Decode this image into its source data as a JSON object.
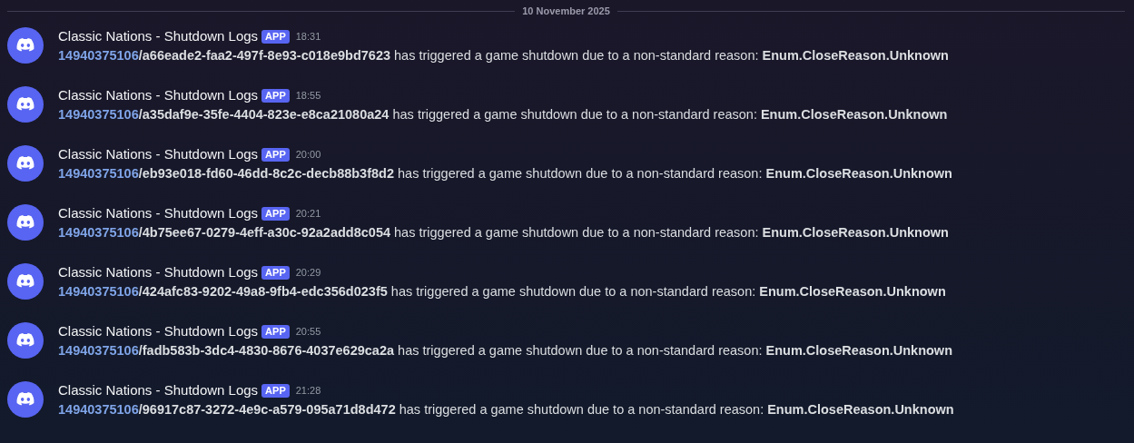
{
  "date_divider": "10 November 2025",
  "messages": [
    {
      "author": "Classic Nations - Shutdown Logs",
      "badge": "APP",
      "time": "18:31",
      "link": "14940375106",
      "text": "**/a66eade2-faa2-497f-8e93-c018e9bd7623** has triggered a game shutdown due to a non-standard reason: **Enum.CloseReason.Unknown**"
    },
    {
      "author": "Classic Nations - Shutdown Logs",
      "badge": "APP",
      "time": "18:55",
      "link": "14940375106",
      "text": "**/a35daf9e-35fe-4404-823e-e8ca21080a24** has triggered a game shutdown due to a non-standard reason: **Enum.CloseReason.Unknown**"
    },
    {
      "author": "Classic Nations - Shutdown Logs",
      "badge": "APP",
      "time": "20:00",
      "link": "14940375106",
      "text": "**/eb93e018-fd60-46dd-8c2c-decb88b3f8d2** has triggered a game shutdown due to a non-standard reason: **Enum.CloseReason.Unknown**"
    },
    {
      "author": "Classic Nations - Shutdown Logs",
      "badge": "APP",
      "time": "20:21",
      "link": "14940375106",
      "text": "**/4b75ee67-0279-4eff-a30c-92a2add8c054** has triggered a game shutdown due to a non-standard reason: **Enum.CloseReason.Unknown**"
    },
    {
      "author": "Classic Nations - Shutdown Logs",
      "badge": "APP",
      "time": "20:29",
      "link": "14940375106",
      "text": "**/424afc83-9202-49a8-9fb4-edc356d023f5** has triggered a game shutdown due to a non-standard reason: **Enum.CloseReason.Unknown**"
    },
    {
      "author": "Classic Nations - Shutdown Logs",
      "badge": "APP",
      "time": "20:55",
      "link": "14940375106",
      "text": "**/fadb583b-3dc4-4830-8676-4037e629ca2a** has triggered a game shutdown due to a non-standard reason: **Enum.CloseReason.Unknown**"
    },
    {
      "author": "Classic Nations - Shutdown Logs",
      "badge": "APP",
      "time": "21:28",
      "link": "14940375106",
      "text": "**/96917c87-3272-4e9c-a579-095a71d8d472** has triggered a game shutdown due to a non-standard reason: **Enum.CloseReason.Unknown**"
    }
  ]
}
